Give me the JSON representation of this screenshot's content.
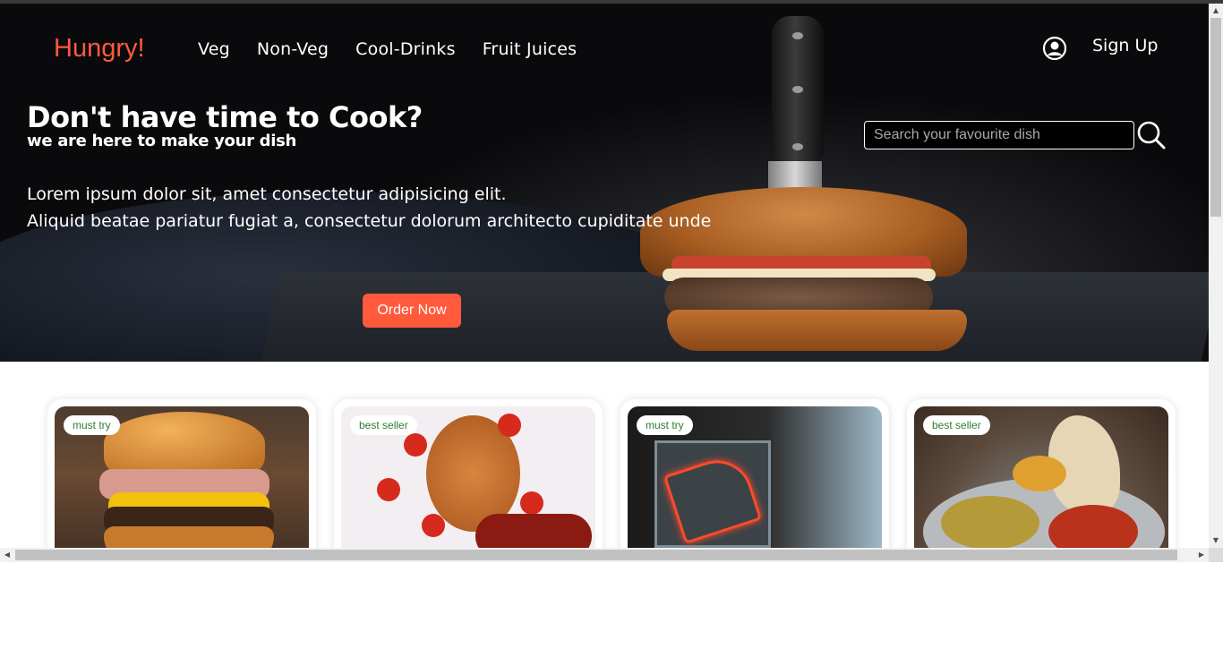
{
  "brand": {
    "name": "Hungry!",
    "accent": "#ff5a3c"
  },
  "nav": {
    "links": [
      "Veg",
      "Non-Veg",
      "Cool-Drinks",
      "Fruit Juices"
    ],
    "user_icon": "user-circle-icon",
    "signup_label": "Sign Up"
  },
  "hero": {
    "title": "Don't have time to Cook?",
    "subtitle": "we are here to make your dish",
    "description_line1": "Lorem ipsum dolor sit, amet consectetur adipisicing elit.",
    "description_line2": "Aliquid beatae pariatur fugiat a, consectetur dolorum architecto cupiditate unde",
    "cta_label": "Order Now"
  },
  "search": {
    "placeholder": "Search your favourite dish",
    "value": "",
    "icon": "search-icon"
  },
  "cards": [
    {
      "tag": "must try",
      "image": "burger"
    },
    {
      "tag": "best seller",
      "image": "pasta"
    },
    {
      "tag": "must try",
      "image": "neon-pizza-sign"
    },
    {
      "tag": "best seller",
      "image": "thali"
    }
  ],
  "colors": {
    "tag_text": "#2e7d32",
    "hero_bg": "#000000",
    "cta": "#ff5a3c"
  }
}
